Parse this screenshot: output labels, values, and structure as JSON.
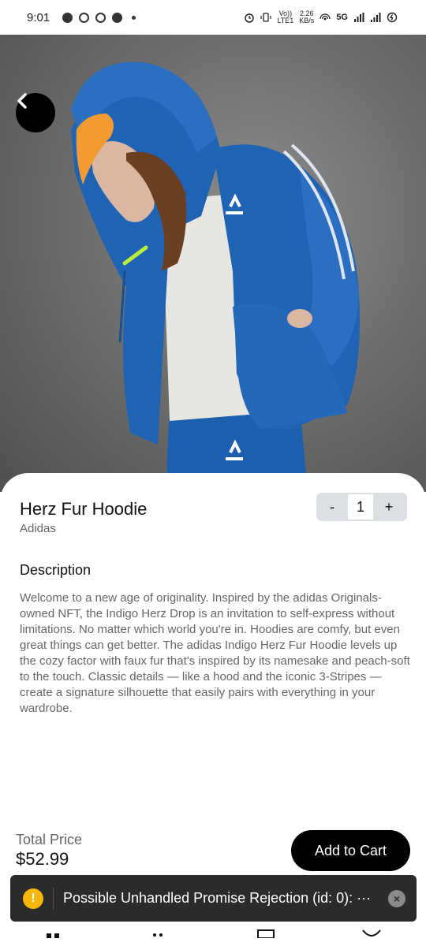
{
  "status_bar": {
    "time": "9:01",
    "speed_value": "2.26",
    "speed_unit": "KB/s",
    "network": "5G",
    "volte_top": "Vo))",
    "volte_bottom": "LTE1"
  },
  "product": {
    "title": "Herz Fur Hoodie",
    "brand": "Adidas"
  },
  "quantity": {
    "minus_label": "-",
    "value": "1",
    "plus_label": "+"
  },
  "description": {
    "heading": "Description",
    "text": "Welcome to a new age of originality. Inspired by the adidas Originals-owned NFT, the Indigo Herz Drop is an invitation to self-express without limitations. No matter which world you're in.  Hoodies are comfy, but even great things can get better. The adidas Indigo Herz Fur Hoodie levels up the cozy factor with faux fur that's inspired by its namesake and peach-soft to the touch. Classic details — like a hood and the iconic 3-Stripes — create a signature silhouette that easily pairs with everything in your wardrobe."
  },
  "footer": {
    "total_label": "Total Price",
    "total_price": "$52.99",
    "add_to_cart_label": "Add to Cart"
  },
  "toast": {
    "message": "Possible Unhandled Promise Rejection (id: 0): ···",
    "warn_symbol": "!",
    "close_symbol": "×"
  },
  "colors": {
    "accent": "#000000",
    "hoodie_blue": "#1f63b5",
    "warning": "#f5b70a"
  },
  "icons": {
    "back": "chevron-left-icon",
    "bottom_nav": [
      "home-icon",
      "cart-icon",
      "mail-icon",
      "profile-icon"
    ]
  }
}
